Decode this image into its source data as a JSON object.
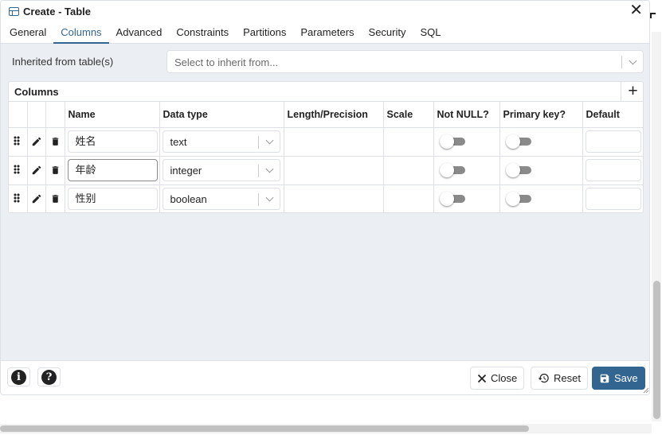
{
  "dialog": {
    "title": "Create - Table",
    "close_glyph": "✕"
  },
  "tabs": [
    {
      "label": "General",
      "active": false
    },
    {
      "label": "Columns",
      "active": true
    },
    {
      "label": "Advanced",
      "active": false
    },
    {
      "label": "Constraints",
      "active": false
    },
    {
      "label": "Partitions",
      "active": false
    },
    {
      "label": "Parameters",
      "active": false
    },
    {
      "label": "Security",
      "active": false
    },
    {
      "label": "SQL",
      "active": false
    }
  ],
  "inherit": {
    "label": "Inherited from table(s)",
    "placeholder": "Select to inherit from..."
  },
  "columns_panel": {
    "title": "Columns",
    "add_glyph": "+",
    "headers": {
      "name": "Name",
      "data_type": "Data type",
      "length": "Length/Precision",
      "scale": "Scale",
      "not_null": "Not NULL?",
      "primary_key": "Primary key?",
      "default": "Default"
    },
    "rows": [
      {
        "name": "姓名",
        "data_type": "text",
        "not_null": false,
        "primary_key": false,
        "focused": false
      },
      {
        "name": "年龄",
        "data_type": "integer",
        "not_null": false,
        "primary_key": false,
        "focused": true
      },
      {
        "name": "性别",
        "data_type": "boolean",
        "not_null": false,
        "primary_key": false,
        "focused": false
      }
    ]
  },
  "footer": {
    "info_glyph": "i",
    "help_glyph": "?",
    "close_label": "Close",
    "reset_label": "Reset",
    "save_label": "Save"
  },
  "colors": {
    "accent": "#326690",
    "toggle_off": "#8a8a8a",
    "panel_bg": "#ebeef3",
    "border": "#dde0e6"
  },
  "icons": [
    "table-icon",
    "close-icon",
    "plus-icon",
    "drag-handle-icon",
    "edit-icon",
    "trash-icon",
    "chevron-down-icon",
    "info-icon",
    "help-icon",
    "reset-icon",
    "save-icon"
  ]
}
